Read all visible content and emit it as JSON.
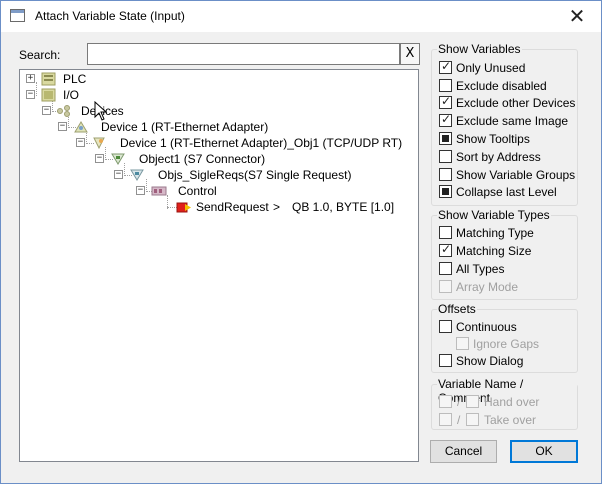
{
  "window": {
    "title": "Attach Variable State (Input)"
  },
  "search": {
    "label": "Search:",
    "value": "",
    "clear": "X"
  },
  "tree": {
    "plc": "PLC",
    "io": "I/O",
    "devices": "Devices",
    "device1": "Device 1 (RT-Ethernet Adapter)",
    "device1_obj": "Device 1 (RT-Ethernet Adapter)_Obj1 (TCP/UDP RT)",
    "object1": "Object1 (S7 Connector)",
    "objs": "Objs_SigleReqs(S7 Single Request)",
    "control": "Control",
    "send_request": "SendRequest",
    "arrow": ">",
    "mapping": "QB 1.0, BYTE [1.0]"
  },
  "show_variables": {
    "title": "Show Variables",
    "only_unused": "Only Unused",
    "exclude_disabled": "Exclude disabled",
    "exclude_other_devices": "Exclude other Devices",
    "exclude_same_image": "Exclude same Image",
    "show_tooltips": "Show Tooltips",
    "sort_by_address": "Sort by Address",
    "show_variable_groups": "Show Variable Groups",
    "collapse_last_level": "Collapse last Level"
  },
  "show_variable_types": {
    "title": "Show Variable Types",
    "matching_type": "Matching Type",
    "matching_size": "Matching Size",
    "all_types": "All Types",
    "array_mode": "Array Mode"
  },
  "offsets": {
    "title": "Offsets",
    "continuous": "Continuous",
    "ignore_gaps": "Ignore Gaps",
    "show_dialog": "Show Dialog"
  },
  "variable_name": {
    "title": "Variable Name / Comment",
    "sep1": "/",
    "hand_over": "Hand over",
    "sep2": "/",
    "take_over": "Take over"
  },
  "buttons": {
    "cancel": "Cancel",
    "ok": "OK"
  },
  "states": {
    "only_unused": true,
    "exclude_disabled": false,
    "exclude_other_devices": true,
    "exclude_same_image": true,
    "show_tooltips": "indeterminate",
    "sort_by_address": false,
    "show_variable_groups": false,
    "collapse_last_level": "indeterminate",
    "matching_type": false,
    "matching_size": true,
    "all_types": false,
    "array_mode": false,
    "continuous": false,
    "ignore_gaps": false,
    "show_dialog": false
  },
  "colors": {
    "accent": "#0078d7",
    "send_request_icon": "#e0201b"
  }
}
